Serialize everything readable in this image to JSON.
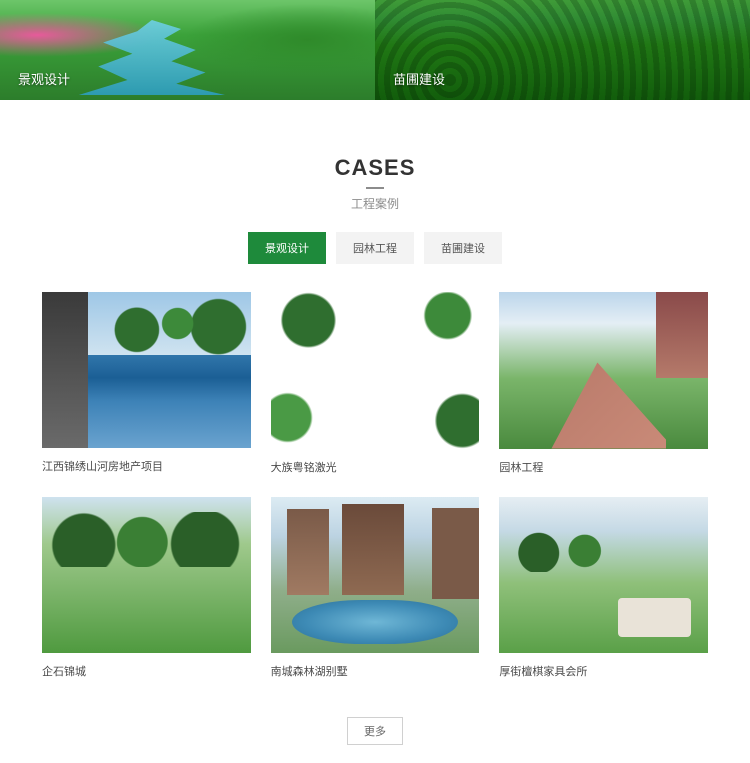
{
  "hero": {
    "left_label": "景观设计",
    "right_label": "苗圃建设"
  },
  "section": {
    "title_en": "CASES",
    "title_cn": "工程案例"
  },
  "tabs": [
    {
      "label": "景观设计",
      "active": true
    },
    {
      "label": "园林工程",
      "active": false
    },
    {
      "label": "苗圃建设",
      "active": false
    }
  ],
  "cases": [
    {
      "caption": "江西锦绣山河房地产项目"
    },
    {
      "caption": "大族粤铭激光"
    },
    {
      "caption": "园林工程"
    },
    {
      "caption": "企石锦城"
    },
    {
      "caption": "南城森林湖别墅"
    },
    {
      "caption": "厚街檀棋家具会所"
    }
  ],
  "more_label": "更多"
}
